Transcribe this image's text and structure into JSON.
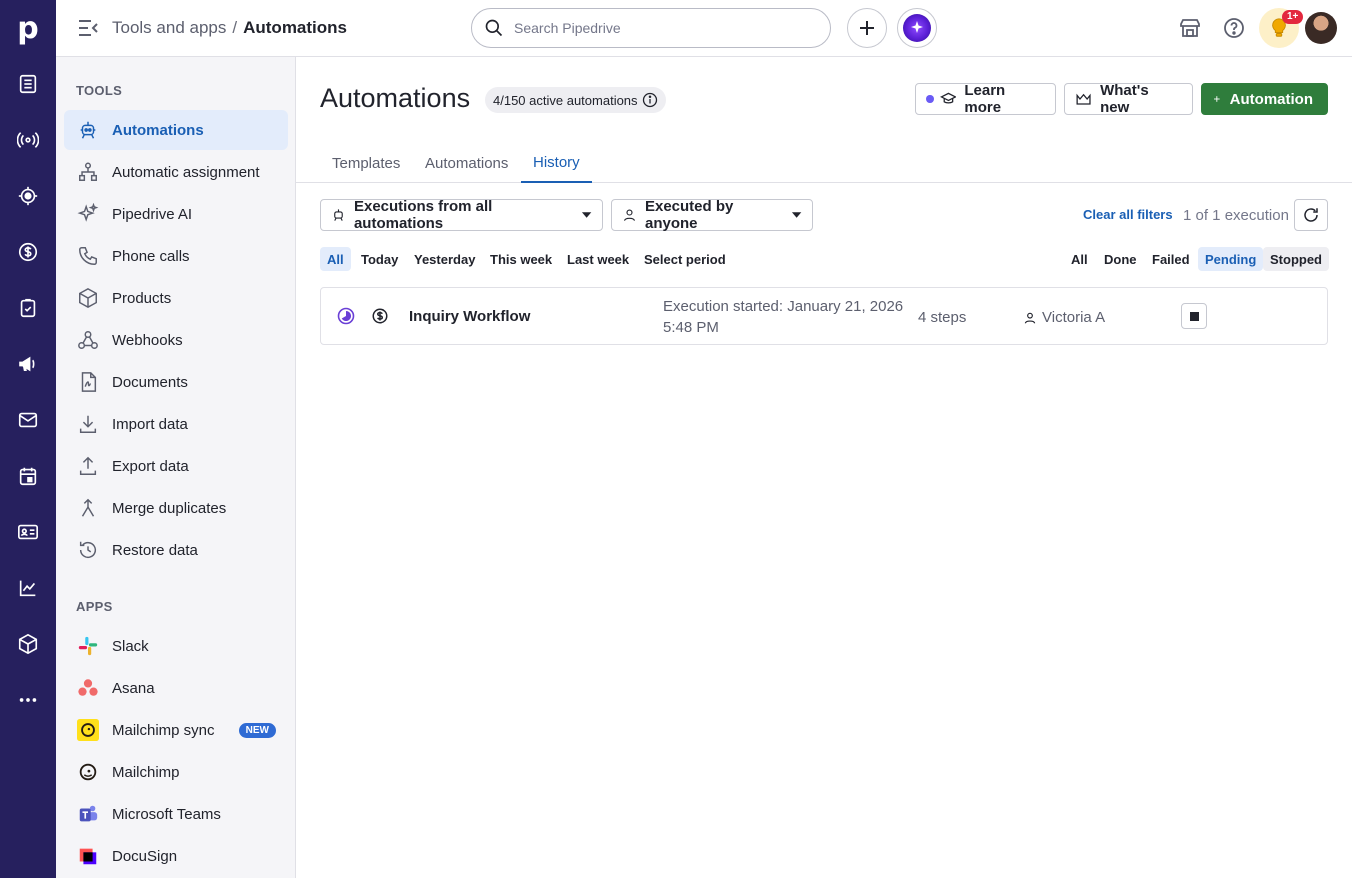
{
  "header": {
    "breadcrumb_parent": "Tools and apps",
    "breadcrumb_sep": "/",
    "breadcrumb_current": "Automations",
    "search_placeholder": "Search Pipedrive",
    "notification_badge": "1+"
  },
  "rail": {
    "logo": "p",
    "icons": [
      "leads-icon",
      "campaigns-broadcast-icon",
      "target-icon",
      "deals-dollar-icon",
      "tasks-clipboard-icon",
      "megaphone-icon",
      "mail-icon",
      "calendar-icon",
      "contacts-card-icon",
      "insights-chart-icon",
      "products-box-icon",
      "more-icon"
    ]
  },
  "sidebar": {
    "tools_header": "TOOLS",
    "tools": [
      {
        "label": "Automations",
        "icon": "automations-robot-icon"
      },
      {
        "label": "Automatic assignment",
        "icon": "assignment-tree-icon"
      },
      {
        "label": "Pipedrive AI",
        "icon": "sparkle-icon"
      },
      {
        "label": "Phone calls",
        "icon": "phone-icon"
      },
      {
        "label": "Products",
        "icon": "box-icon"
      },
      {
        "label": "Webhooks",
        "icon": "webhook-icon"
      },
      {
        "label": "Documents",
        "icon": "document-icon"
      },
      {
        "label": "Import data",
        "icon": "download-icon"
      },
      {
        "label": "Export data",
        "icon": "upload-icon"
      },
      {
        "label": "Merge duplicates",
        "icon": "merge-icon"
      },
      {
        "label": "Restore data",
        "icon": "restore-clock-icon"
      }
    ],
    "apps_header": "APPS",
    "apps": [
      {
        "label": "Slack",
        "icon": "slack-logo-icon"
      },
      {
        "label": "Asana",
        "icon": "asana-logo-icon"
      },
      {
        "label": "Mailchimp sync",
        "icon": "mailchimp-logo-icon",
        "badge": "NEW"
      },
      {
        "label": "Mailchimp",
        "icon": "mailchimp-logo-icon"
      },
      {
        "label": "Microsoft Teams",
        "icon": "teams-logo-icon"
      },
      {
        "label": "DocuSign",
        "icon": "docusign-logo-icon"
      }
    ]
  },
  "main": {
    "title": "Automations",
    "active_count": "4/150 active automations",
    "learn_more": "Learn more",
    "whats_new": "What's new",
    "add_automation": "Automation",
    "tabs": [
      "Templates",
      "Automations",
      "History"
    ],
    "active_tab": "History",
    "filter_automations": "Executions from all automations",
    "filter_executor": "Executed by anyone",
    "clear_filters": "Clear all filters",
    "execution_count": "1 of 1 execution",
    "period_chips": [
      "All",
      "Today",
      "Yesterday",
      "This week",
      "Last week",
      "Select period"
    ],
    "status_chips": [
      "All",
      "Done",
      "Failed",
      "Pending",
      "Stopped"
    ],
    "executions": [
      {
        "name": "Inquiry Workflow",
        "started_line1": "Execution started: January 21, 2026",
        "started_line2": "5:48 PM",
        "steps": "4 steps",
        "user": "Victoria A"
      }
    ]
  },
  "colors": {
    "rail": "#26205e",
    "accent_blue": "#1a5fb4",
    "green": "#2f7d3c",
    "badge_red": "#e3283e"
  }
}
